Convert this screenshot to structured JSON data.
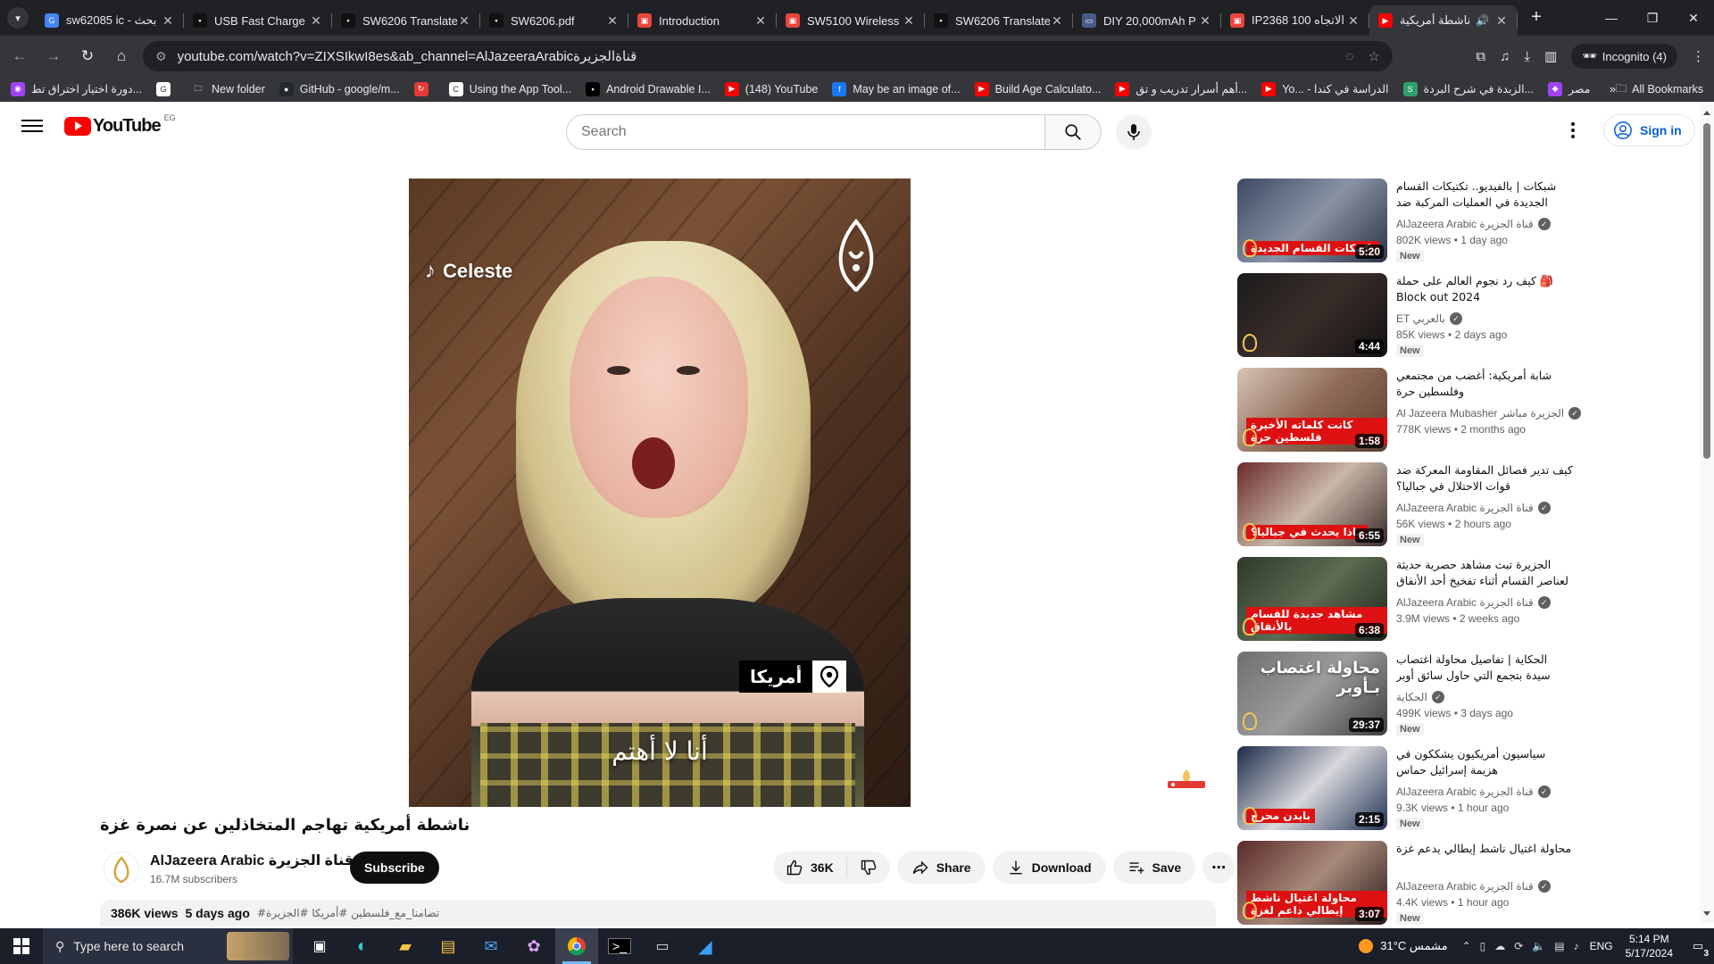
{
  "browser": {
    "tabs": [
      {
        "title": "sw62085 ic - بحث",
        "color": "#4285f4",
        "glyph": "G",
        "active": false
      },
      {
        "title": "USB Fast Charge M",
        "color": "#111111",
        "glyph": "▪",
        "active": false
      },
      {
        "title": "SW6206 Translate",
        "color": "#111111",
        "glyph": "▪",
        "active": false
      },
      {
        "title": "SW6206.pdf",
        "color": "#111111",
        "glyph": "▪",
        "active": false
      },
      {
        "title": "Introduction",
        "color": "#e8453c",
        "glyph": "▣",
        "active": false
      },
      {
        "title": "SW5100 Wireless",
        "color": "#e8453c",
        "glyph": "▣",
        "active": false
      },
      {
        "title": "SW6206 Translate",
        "color": "#111111",
        "glyph": "▪",
        "active": false
      },
      {
        "title": "DIY 20,000mAh P",
        "color": "#4a5a8a",
        "glyph": "▭",
        "active": false
      },
      {
        "title": "IP2368 100 الاتجاه",
        "color": "#e8453c",
        "glyph": "▣",
        "active": false
      },
      {
        "title": "ناشطة أمريكية",
        "color": "#ff0000",
        "glyph": "▶",
        "active": true
      }
    ],
    "new_tab_label": "+",
    "url": "youtube.com/watch?v=ZIXSIkwI8es&ab_channel=AlJazeeraArabicقناةالجزيرة",
    "incognito_label": "Incognito (4)",
    "bookmarks": [
      {
        "label": "دورة اختيار اختراق تط...",
        "color": "#a142f4",
        "glyph": "◉"
      },
      {
        "label": "",
        "color": "#ffffff",
        "glyph": "G"
      },
      {
        "label": "New folder",
        "color": "transparent",
        "glyph": "🗀"
      },
      {
        "label": "GitHub - google/m...",
        "color": "#24292e",
        "glyph": "●"
      },
      {
        "label": "",
        "color": "#e53935",
        "glyph": "↻"
      },
      {
        "label": "Using the App Tool...",
        "color": "#ffffff",
        "glyph": "C"
      },
      {
        "label": "Android Drawable I...",
        "color": "#000000",
        "glyph": "▪"
      },
      {
        "label": "(148) YouTube",
        "color": "#ff0000",
        "glyph": "▶"
      },
      {
        "label": "May be an image of...",
        "color": "#1877f2",
        "glyph": "f"
      },
      {
        "label": "Build Age Calculato...",
        "color": "#ff0000",
        "glyph": "▶"
      },
      {
        "label": "أهم أسرار تدريب و تق...",
        "color": "#ff0000",
        "glyph": "▶"
      },
      {
        "label": "Yo... - الدراسة في كندا",
        "color": "#ff0000",
        "glyph": "▶"
      },
      {
        "label": "الزبدة في شرح البردة...",
        "color": "#2e9e6a",
        "glyph": "S"
      },
      {
        "label": "مصر",
        "color": "#a142f4",
        "glyph": "◆"
      }
    ],
    "bookmarks_more": "»",
    "all_bookmarks_label": "All Bookmarks"
  },
  "youtube": {
    "logo_text": "YouTube",
    "country_code": "EG",
    "search_placeholder": "Search",
    "signin_label": "Sign in",
    "video": {
      "overlay_source": "Celeste",
      "location_label": "أمريكا",
      "caption": "أنا لا أهتم",
      "title": "ناشطة أمريكية تهاجم المتخاذلين عن نصرة غزة"
    },
    "channel": {
      "name": "AlJazeera Arabic قناة الجزيرة",
      "subscribers": "16.7M subscribers",
      "subscribe_label": "Subscribe"
    },
    "actions": {
      "likes": "36K",
      "share": "Share",
      "download": "Download",
      "save": "Save"
    },
    "description": {
      "views": "386K views",
      "age": "5 days ago",
      "tags": "#تضامنا_مع_فلسطين #أمريكا #الجزيرة"
    },
    "recommendations": [
      {
        "title": "شبكات | بالفيديو.. تكتيكات القسام الجديدة في العمليات المركبة ضد جيش الاحتلال",
        "channel": "AlJazeera Arabic قناة الجزيرة",
        "verified": true,
        "views": "802K views",
        "age": "1 day ago",
        "badge": "New",
        "duration": "5:20",
        "thumb": "linear-gradient(135deg,#3b4a63,#8a93a5 50%,#2a3246)",
        "thumb_text": "تكتيكات القسام الجديدة"
      },
      {
        "title": "🎒 كيف رد نجوم العالم على حملة Block out 2024",
        "channel": "ET بالعربي",
        "verified": true,
        "views": "85K views",
        "age": "2 days ago",
        "badge": "New",
        "duration": "4:44",
        "thumb": "linear-gradient(135deg,#1b1b1b,#3a2e2a 50%,#111)",
        "thumb_text": ""
      },
      {
        "title": "شابة أمريكية: أغضب من مجتمعي وفلسطين حرة",
        "channel": "Al Jazeera Mubasher الجزيرة مباشر",
        "verified": true,
        "views": "778K views",
        "age": "2 months ago",
        "badge": "",
        "duration": "1:58",
        "thumb": "linear-gradient(135deg,#d7c4b6,#8e6b57 50%,#5a4030)",
        "thumb_text": "كانت كلماته الأخيرة فلسطين حرة"
      },
      {
        "title": "كيف تدير فصائل المقاومة المعركة ضد قوات الاحتلال في جباليا؟",
        "channel": "AlJazeera Arabic قناة الجزيرة",
        "verified": true,
        "views": "56K views",
        "age": "2 hours ago",
        "badge": "New",
        "duration": "6:55",
        "thumb": "linear-gradient(135deg,#6b2a2a,#c9b8a8 50%,#3a2a2a)",
        "thumb_text": "ماذا يحدث في جباليا؟"
      },
      {
        "title": "الجزيرة تبث مشاهد حصرية حديثة لعناصر القسام أثناء تفخيخ أحد الأنفاق في قطاع غزة",
        "channel": "AlJazeera Arabic قناة الجزيرة",
        "verified": true,
        "views": "3.9M views",
        "age": "2 weeks ago",
        "badge": "",
        "duration": "6:38",
        "thumb": "linear-gradient(135deg,#2e3a2a,#5d6b52 50%,#1e261a)",
        "thumb_text": "مشاهد جديدة للقسام بالأنفاق"
      },
      {
        "title": "الحكاية | تفاصيل محاولة اغتصاب سيدة بتجمع التي حاول سائق أوبر التعدي عليها وا...",
        "channel": "الحكاية",
        "verified": true,
        "views": "499K views",
        "age": "3 days ago",
        "badge": "New",
        "duration": "29:37",
        "thumb": "linear-gradient(135deg,#6d6f70,#9a9c9d 50%,#3c3e3f)",
        "thumb_text": "محاولة اغتصاب بـأوبر"
      },
      {
        "title": "سياسيون أمريكيون يشككون في هزيمة إسرائيل حماس",
        "channel": "AlJazeera Arabic قناة الجزيرة",
        "verified": true,
        "views": "9.3K views",
        "age": "1 hour ago",
        "badge": "New",
        "duration": "2:15",
        "thumb": "linear-gradient(135deg,#1c2b4a,#d8d8dc 50%,#243456)",
        "thumb_text": "بايدن محرج"
      },
      {
        "title": "محاولة اغتيال ناشط إيطالي يدعم غزة",
        "channel": "AlJazeera Arabic قناة الجزيرة",
        "verified": true,
        "views": "4.4K views",
        "age": "1 hour ago",
        "badge": "New",
        "duration": "3:07",
        "thumb": "linear-gradient(135deg,#5a2a2a,#a88a7a 50%,#2a1a1a)",
        "thumb_text": "محاولة اغتيال ناشط إيطالي داعم لغزة"
      }
    ]
  },
  "taskbar": {
    "search_placeholder": "Type here to search",
    "weather": "31°C  مشمس",
    "language": "ENG",
    "time": "5:14 PM",
    "date": "5/17/2024",
    "notifications": "3"
  }
}
